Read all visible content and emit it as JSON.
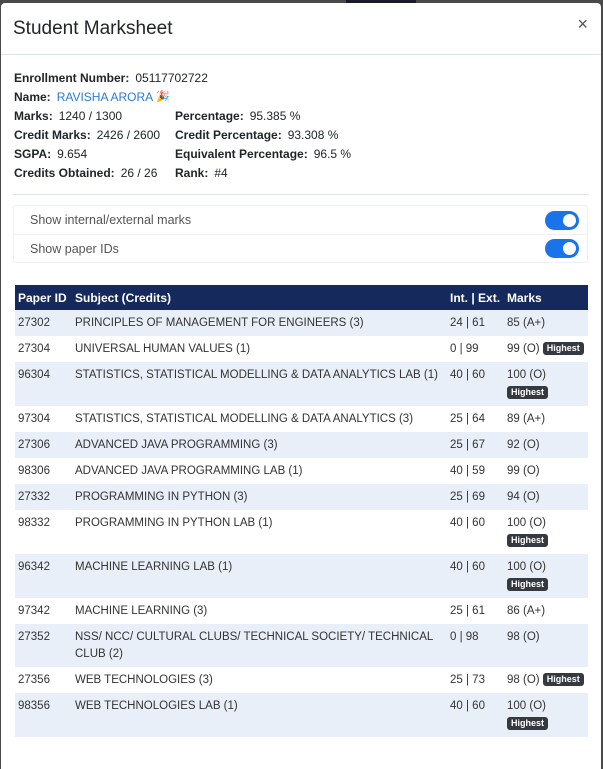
{
  "modal": {
    "title": "Student Marksheet",
    "close": "×"
  },
  "info": {
    "enrollment_label": "Enrollment Number:",
    "enrollment": "05117702722",
    "name_label": "Name:",
    "name": "RAVISHA ARORA",
    "name_emoji": "🎉",
    "marks_label": "Marks:",
    "marks": "1240 / 1300",
    "percentage_label": "Percentage:",
    "percentage": "95.385 %",
    "credit_marks_label": "Credit Marks:",
    "credit_marks": "2426 / 2600",
    "credit_percentage_label": "Credit Percentage:",
    "credit_percentage": "93.308 %",
    "sgpa_label": "SGPA:",
    "sgpa": "9.654",
    "equiv_label": "Equivalent Percentage:",
    "equiv": "96.5 %",
    "credits_label": "Credits Obtained:",
    "credits": "26 / 26",
    "rank_label": "Rank:",
    "rank": "#4"
  },
  "toggles": [
    {
      "label": "Show internal/external marks",
      "on": true
    },
    {
      "label": "Show paper IDs",
      "on": true
    }
  ],
  "table": {
    "headers": [
      "Paper ID",
      "Subject (Credits)",
      "Int. | Ext.",
      "Marks"
    ],
    "badge_label": "Highest",
    "rows": [
      {
        "id": "27302",
        "subject": "PRINCIPLES OF MANAGEMENT FOR ENGINEERS (3)",
        "ie": "24 | 61",
        "marks": "85 (A+)",
        "highest": false
      },
      {
        "id": "27304",
        "subject": "UNIVERSAL HUMAN VALUES (1)",
        "ie": "0 | 99",
        "marks": "99 (O)",
        "highest": true
      },
      {
        "id": "96304",
        "subject": "STATISTICS, STATISTICAL MODELLING & DATA ANALYTICS LAB (1)",
        "ie": "40 | 60",
        "marks": "100 (O)",
        "highest": true
      },
      {
        "id": "97304",
        "subject": "STATISTICS, STATISTICAL MODELLING & DATA ANALYTICS (3)",
        "ie": "25 | 64",
        "marks": "89 (A+)",
        "highest": false
      },
      {
        "id": "27306",
        "subject": "ADVANCED JAVA PROGRAMMING (3)",
        "ie": "25 | 67",
        "marks": "92 (O)",
        "highest": false
      },
      {
        "id": "98306",
        "subject": "ADVANCED JAVA PROGRAMMING LAB (1)",
        "ie": "40 | 59",
        "marks": "99 (O)",
        "highest": false
      },
      {
        "id": "27332",
        "subject": "PROGRAMMING IN PYTHON (3)",
        "ie": "25 | 69",
        "marks": "94 (O)",
        "highest": false
      },
      {
        "id": "98332",
        "subject": "PROGRAMMING IN PYTHON LAB (1)",
        "ie": "40 | 60",
        "marks": "100 (O)",
        "highest": true
      },
      {
        "id": "96342",
        "subject": "MACHINE LEARNING LAB (1)",
        "ie": "40 | 60",
        "marks": "100 (O)",
        "highest": true
      },
      {
        "id": "97342",
        "subject": "MACHINE LEARNING (3)",
        "ie": "25 | 61",
        "marks": "86 (A+)",
        "highest": false
      },
      {
        "id": "27352",
        "subject": "NSS/ NCC/ CULTURAL CLUBS/ TECHNICAL SOCIETY/ TECHNICAL CLUB (2)",
        "ie": "0 | 98",
        "marks": "98 (O)",
        "highest": false
      },
      {
        "id": "27356",
        "subject": "WEB TECHNOLOGIES (3)",
        "ie": "25 | 73",
        "marks": "98 (O)",
        "highest": true
      },
      {
        "id": "98356",
        "subject": "WEB TECHNOLOGIES LAB (1)",
        "ie": "40 | 60",
        "marks": "100 (O)",
        "highest": true
      }
    ]
  }
}
